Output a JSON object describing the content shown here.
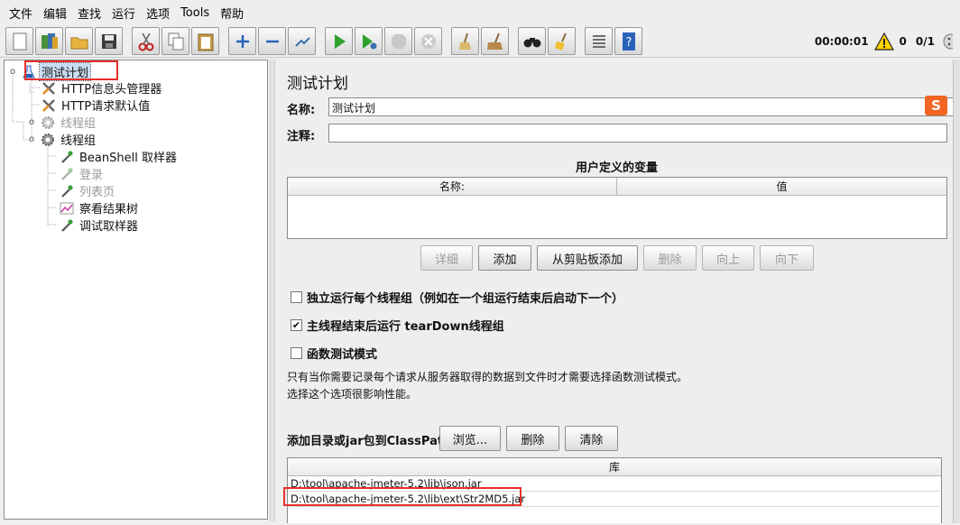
{
  "menu": [
    "文件",
    "编辑",
    "查找",
    "运行",
    "选项",
    "Tools",
    "帮助"
  ],
  "toolbar": {
    "buttons": [
      "new",
      "templates",
      "open",
      "save",
      "cut",
      "copy",
      "paste",
      "expand",
      "collapse",
      "toggle",
      "start",
      "start-no-pauses",
      "stop",
      "shutdown",
      "clear",
      "clear-all",
      "search",
      "reset-search",
      "function-helper",
      "help"
    ],
    "elapsed": "00:00:01",
    "warnings": "0",
    "threads": "0/1"
  },
  "tree": {
    "root": "测试计划",
    "items": [
      {
        "label": "HTTP信息头管理器",
        "icon": "wrench-icon",
        "enabled": true
      },
      {
        "label": "HTTP请求默认值",
        "icon": "wrench-icon",
        "enabled": true
      },
      {
        "label": "线程组",
        "icon": "gear-icon",
        "enabled": false
      },
      {
        "label": "线程组",
        "icon": "gear-icon",
        "enabled": true
      },
      {
        "label": "BeanShell 取样器",
        "icon": "dropper-icon",
        "enabled": true
      },
      {
        "label": "登录",
        "icon": "dropper-icon",
        "enabled": false
      },
      {
        "label": "列表页",
        "icon": "dropper-icon",
        "enabled": false
      },
      {
        "label": "察看结果树",
        "icon": "chart-icon",
        "enabled": true
      },
      {
        "label": "调试取样器",
        "icon": "dropper-icon",
        "enabled": true
      }
    ]
  },
  "panel": {
    "title": "测试计划",
    "name_label": "名称:",
    "name_value": "测试计划",
    "comment_label": "注释:",
    "comment_value": "",
    "vars_title": "用户定义的变量",
    "vars_col_name": "名称:",
    "vars_col_value": "值",
    "btn_detail": "详细",
    "btn_add": "添加",
    "btn_add_clipboard": "从剪贴板添加",
    "btn_delete": "删除",
    "btn_up": "向上",
    "btn_down": "向下",
    "cb_serialize": "独立运行每个线程组（例如在一个组运行结束后启动下一个）",
    "cb_serialize_checked": false,
    "cb_teardown": "主线程结束后运行 tearDown线程组",
    "cb_teardown_checked": true,
    "cb_functional": "函数测试模式",
    "cb_functional_checked": false,
    "note_line1": "只有当你需要记录每个请求从服务器取得的数据到文件时才需要选择函数测试模式。",
    "note_line2": "选择这个选项很影响性能。",
    "classpath_label": "添加目录或jar包到ClassPath",
    "btn_browse": "浏览...",
    "btn_cp_delete": "删除",
    "btn_cp_clear": "清除",
    "lib_header": "库",
    "lib_rows": [
      "D:\\tool\\apache-jmeter-5.2\\lib\\json.jar",
      "D:\\tool\\apache-jmeter-5.2\\lib\\ext\\Str2MD5.jar"
    ]
  },
  "ime_badge": "S"
}
